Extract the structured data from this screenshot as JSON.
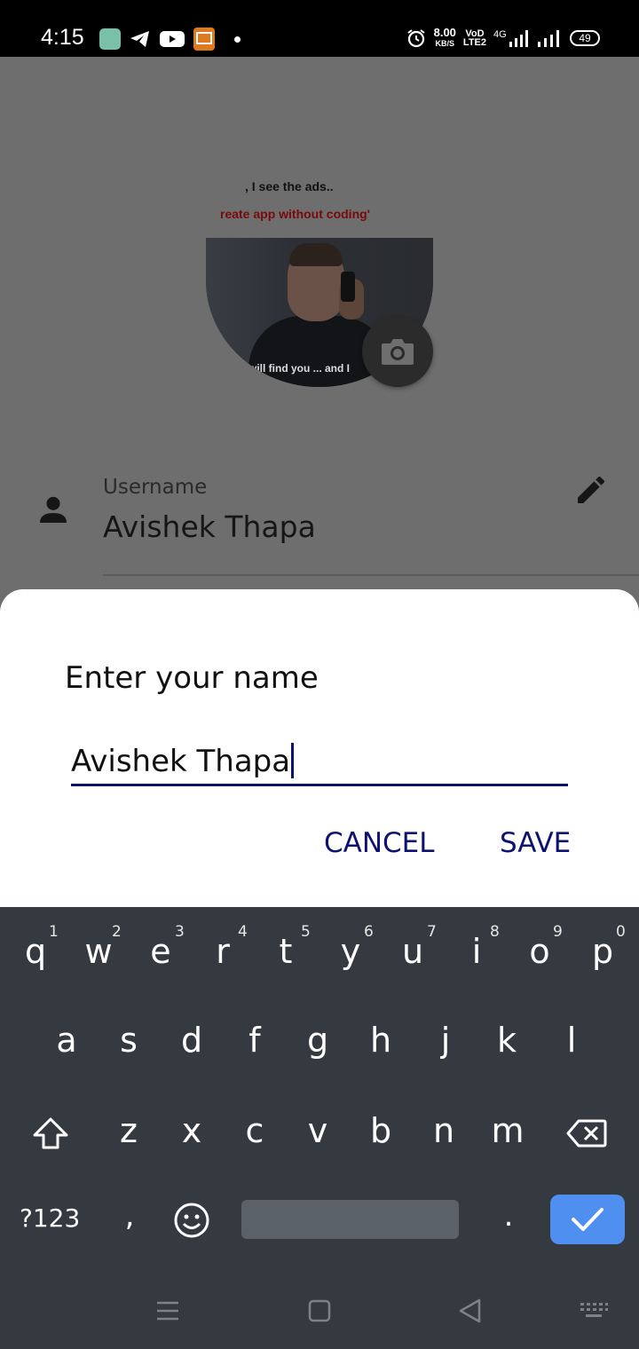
{
  "status_bar": {
    "time": "4:15",
    "speed_value": "8.00",
    "speed_unit": "KB/S",
    "volte_top": "VoD",
    "volte_bottom": "LTE2",
    "network": "4G",
    "battery": "49"
  },
  "profile": {
    "meme_line1": ", I see the ads..",
    "meme_line2": "reate app without coding'",
    "meme_line3": "will find you ... and I",
    "username_label": "Username",
    "username_value": "Avishek Thapa"
  },
  "dialog": {
    "title": "Enter your name",
    "input_value": "Avishek Thapa",
    "cancel_label": "CANCEL",
    "save_label": "SAVE"
  },
  "keyboard": {
    "row1": [
      "q",
      "w",
      "e",
      "r",
      "t",
      "y",
      "u",
      "i",
      "o",
      "p"
    ],
    "row1_hints": [
      "1",
      "2",
      "3",
      "4",
      "5",
      "6",
      "7",
      "8",
      "9",
      "0"
    ],
    "row2": [
      "a",
      "s",
      "d",
      "f",
      "g",
      "h",
      "j",
      "k",
      "l"
    ],
    "row3": [
      "z",
      "x",
      "c",
      "v",
      "b",
      "n",
      "m"
    ],
    "symbols_label": "?123",
    "comma": ",",
    "period": "."
  },
  "colors": {
    "accent": "#0d1270",
    "keyboard_bg": "#343a40",
    "enter_key": "#4f8ff0"
  }
}
